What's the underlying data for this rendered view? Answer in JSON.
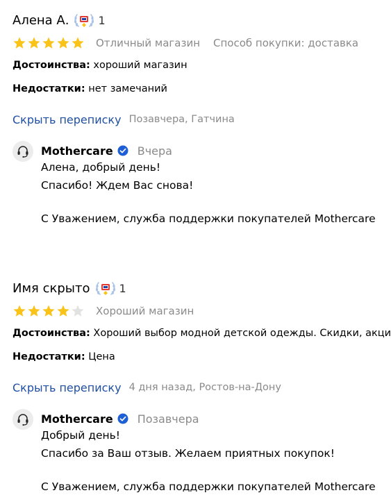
{
  "colors": {
    "star_filled": "#f9c31a",
    "star_empty": "#e2e2e2",
    "link": "#1f4fa3",
    "muted": "#8a8a8a",
    "verified": "#1f5fd6"
  },
  "reviews": [
    {
      "author": "Алена А.",
      "badge_icon": "laurel-badge-icon",
      "badge_count": "1",
      "rating": 5,
      "rating_max": 5,
      "rating_text": "Отличный магазин",
      "purchase_method": "Способ покупки: доставка",
      "pros_label": "Достоинства:",
      "pros_text": " хороший магазин",
      "cons_label": "Недостатки:",
      "cons_text": " нет замечаний",
      "hide_link": "Скрыть переписку",
      "meta": "Позавчера, Гатчина",
      "reply": {
        "name": "Mothercare",
        "date": "Вчера",
        "lines": [
          "Алена, добрый день!",
          "Спасибо! Ждем Вас снова!",
          "",
          "С Уважением, служба поддержки покупателей Mothercare"
        ]
      }
    },
    {
      "author": "Имя скрыто",
      "badge_icon": "laurel-badge-icon",
      "badge_count": "1",
      "rating": 4,
      "rating_max": 5,
      "rating_text": "Хороший магазин",
      "purchase_method": "",
      "pros_label": "Достоинства:",
      "pros_text": " Хороший выбор модной детской одежды. Скидки, акции",
      "cons_label": "Недостатки:",
      "cons_text": " Цена",
      "hide_link": "Скрыть переписку",
      "meta": "4 дня назад, Ростов-на-Дону",
      "reply": {
        "name": "Mothercare",
        "date": "Позавчера",
        "lines": [
          "Добрый день!",
          "Спасибо за Ваш отзыв. Желаем приятных покупок!",
          "",
          "С Уважением, служба поддержки покупателей Mothercare"
        ]
      }
    }
  ]
}
